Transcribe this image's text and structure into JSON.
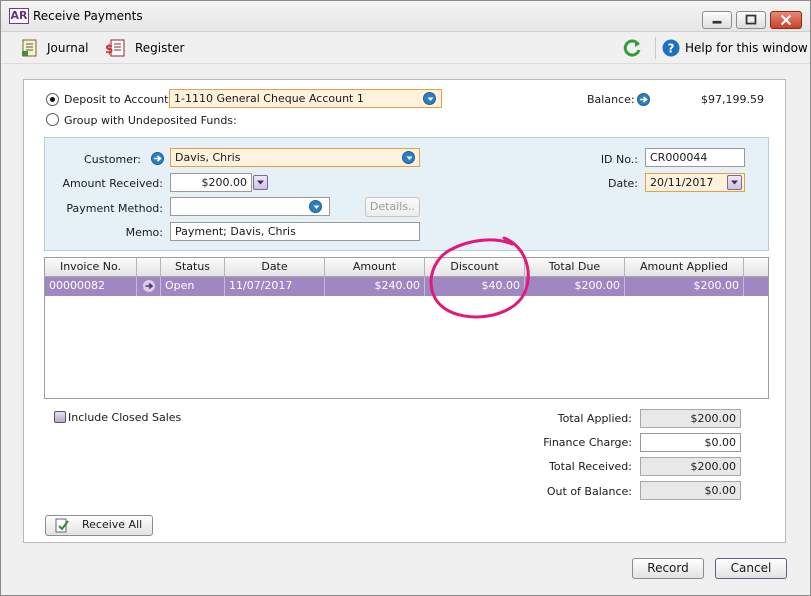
{
  "window": {
    "app_badge": "AR",
    "title": "Receive Payments"
  },
  "toolbar": {
    "journal": "Journal",
    "register": "Register",
    "help": "Help for this window"
  },
  "deposit": {
    "deposit_label": "Deposit to Account:",
    "deposit_selected": true,
    "account": "1-1110 General Cheque Account 1",
    "group_label": "Group with Undeposited Funds:",
    "balance_label": "Balance:",
    "balance_value": "$97,199.59"
  },
  "payment": {
    "customer_label": "Customer:",
    "customer_value": "Davis, Chris",
    "amount_label": "Amount Received:",
    "amount_value": "$200.00",
    "method_label": "Payment Method:",
    "method_value": "",
    "details_label": "Details..",
    "memo_label": "Memo:",
    "memo_value": "Payment; Davis, Chris",
    "id_label": "ID No.:",
    "id_value": "CR000044",
    "date_label": "Date:",
    "date_value": "20/11/2017"
  },
  "table": {
    "columns": [
      "Invoice No.",
      "",
      "Status",
      "Date",
      "Amount",
      "Discount",
      "Total Due",
      "Amount Applied"
    ],
    "rows": [
      {
        "invoice": "00000082",
        "status": "Open",
        "date": "11/07/2017",
        "amount": "$240.00",
        "discount": "$40.00",
        "total_due": "$200.00",
        "applied": "$200.00"
      }
    ]
  },
  "totals": {
    "include_closed": "Include Closed Sales",
    "total_applied_label": "Total Applied:",
    "total_applied": "$200.00",
    "finance_label": "Finance Charge:",
    "finance": "$0.00",
    "total_received_label": "Total Received:",
    "total_received": "$200.00",
    "out_of_balance_label": "Out of Balance:",
    "out_of_balance": "$0.00"
  },
  "buttons": {
    "receive_all": "Receive All",
    "record": "Record",
    "cancel": "Cancel"
  },
  "colors": {
    "selected_row": "#9f88c1",
    "highlight_annotation": "#e0197d",
    "dropdown_blue": "#2d7fc1",
    "required_field": "#fff2dc"
  }
}
